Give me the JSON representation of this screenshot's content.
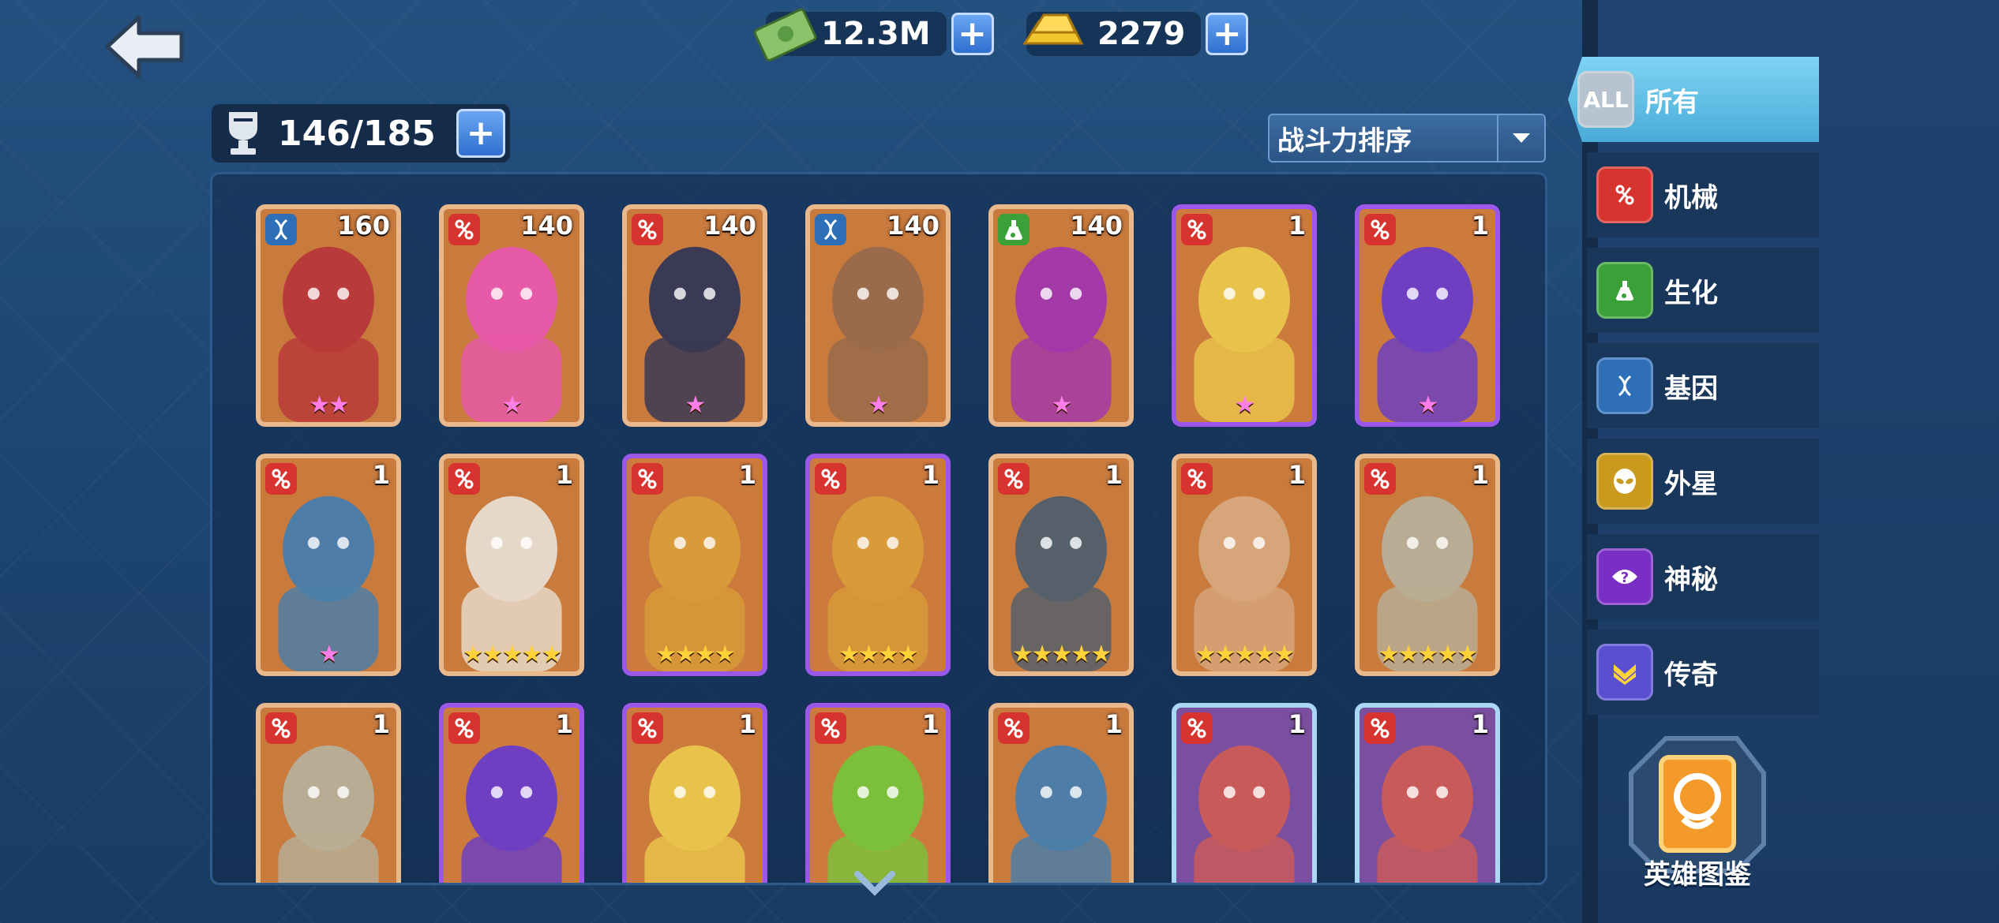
{
  "currency": {
    "cash": "12.3M",
    "gold": "2279"
  },
  "roster": {
    "capacity": "146/185"
  },
  "sort": {
    "label": "战斗力排序"
  },
  "tabs": [
    {
      "label": "所有",
      "icon": "all-icon",
      "badge": "ALL",
      "active": true
    },
    {
      "label": "机械",
      "icon": "mech-icon"
    },
    {
      "label": "生化",
      "icon": "bio-icon"
    },
    {
      "label": "基因",
      "icon": "gene-icon"
    },
    {
      "label": "外星",
      "icon": "alien-icon"
    },
    {
      "label": "神秘",
      "icon": "mystic-icon"
    },
    {
      "label": "传奇",
      "icon": "legend-icon"
    }
  ],
  "codex": {
    "label": "英雄图鉴"
  },
  "heroes": [
    {
      "level": "160",
      "class": "gene",
      "frame": "gold",
      "stars": "★★",
      "star_color": "pink",
      "art": "#b83a3a"
    },
    {
      "level": "140",
      "class": "mech",
      "frame": "gold",
      "stars": "★",
      "star_color": "pink",
      "art": "#e75aa8"
    },
    {
      "level": "140",
      "class": "mech",
      "frame": "gold",
      "stars": "★",
      "star_color": "pink",
      "art": "#3b3a55"
    },
    {
      "level": "140",
      "class": "gene",
      "frame": "gold",
      "stars": "★",
      "star_color": "pink",
      "art": "#9a6a4a"
    },
    {
      "level": "140",
      "class": "bio",
      "frame": "gold",
      "stars": "★",
      "star_color": "pink",
      "art": "#a33aa8"
    },
    {
      "level": "1",
      "class": "mech",
      "frame": "purple",
      "stars": "★",
      "star_color": "pink",
      "art": "#e8c24a"
    },
    {
      "level": "1",
      "class": "mech",
      "frame": "purple",
      "stars": "★",
      "star_color": "pink",
      "art": "#6e3fc0"
    },
    {
      "level": "1",
      "class": "mech",
      "frame": "gold",
      "stars": "★",
      "star_color": "pink",
      "art": "#4e7ea8"
    },
    {
      "level": "1",
      "class": "mech",
      "frame": "gold",
      "stars": "★★★★★",
      "star_color": "gold",
      "art": "#e6d8c8"
    },
    {
      "level": "1",
      "class": "mech",
      "frame": "purple",
      "stars": "★★★★",
      "star_color": "gold",
      "art": "#d89a3a"
    },
    {
      "level": "1",
      "class": "mech",
      "frame": "purple",
      "stars": "★★★★",
      "star_color": "gold",
      "art": "#d89a3a"
    },
    {
      "level": "1",
      "class": "mech",
      "frame": "gold",
      "stars": "★★★★★",
      "star_color": "gold",
      "art": "#56606a"
    },
    {
      "level": "1",
      "class": "mech",
      "frame": "gold",
      "stars": "★★★★★",
      "star_color": "gold",
      "art": "#d6a57a"
    },
    {
      "level": "1",
      "class": "mech",
      "frame": "gold",
      "stars": "★★★★★",
      "star_color": "gold",
      "art": "#b8ad94"
    },
    {
      "level": "1",
      "class": "mech",
      "frame": "gold",
      "stars": "",
      "star_color": "gold",
      "art": "#b8ad94"
    },
    {
      "level": "1",
      "class": "mech",
      "frame": "purple",
      "stars": "",
      "star_color": "gold",
      "art": "#6e3fc0"
    },
    {
      "level": "1",
      "class": "mech",
      "frame": "purple",
      "stars": "",
      "star_color": "gold",
      "art": "#e8c24a"
    },
    {
      "level": "1",
      "class": "mech",
      "frame": "purple",
      "stars": "",
      "star_color": "gold",
      "art": "#7cbf3a"
    },
    {
      "level": "1",
      "class": "mech",
      "frame": "gold",
      "stars": "",
      "star_color": "gold",
      "art": "#4e7ea8"
    },
    {
      "level": "1",
      "class": "mech",
      "frame": "blue",
      "stars": "",
      "star_color": "gold",
      "art": "#c95a5a"
    },
    {
      "level": "1",
      "class": "mech",
      "frame": "blue",
      "stars": "",
      "star_color": "gold",
      "art": "#c95a5a"
    }
  ]
}
